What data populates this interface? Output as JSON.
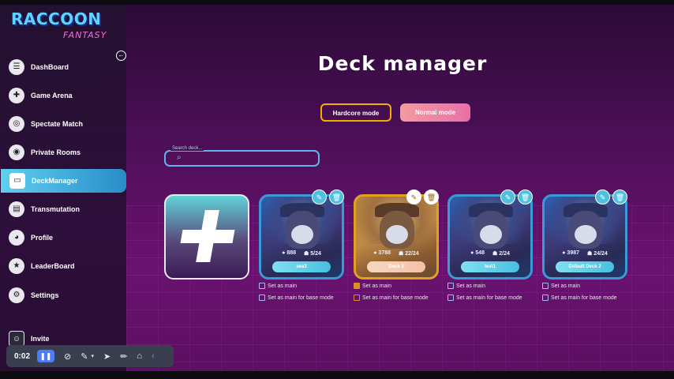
{
  "app": {
    "logo_line1": "RACCOON",
    "logo_line2": "FANTASY"
  },
  "sidebar": {
    "items": [
      {
        "label": "DashBoard",
        "icon": "list-icon",
        "glyph": "☰"
      },
      {
        "label": "Game Arena",
        "icon": "gamepad-icon",
        "glyph": "🎮"
      },
      {
        "label": "Spectate Match",
        "icon": "eye-icon",
        "glyph": "👁"
      },
      {
        "label": "Private Rooms",
        "icon": "globe-icon",
        "glyph": "◉"
      },
      {
        "label": "DeckManager",
        "icon": "deck-icon",
        "glyph": "▭",
        "active": true
      },
      {
        "label": "Transmutation",
        "icon": "window-icon",
        "glyph": "▤"
      },
      {
        "label": "Profile",
        "icon": "raccoon-icon",
        "glyph": "◕"
      },
      {
        "label": "LeaderBoard",
        "icon": "star-icon",
        "glyph": "★"
      },
      {
        "label": "Settings",
        "icon": "gear-icon",
        "glyph": "⚙"
      }
    ],
    "invite_label": "Invite"
  },
  "recorder": {
    "time": "0:02"
  },
  "main": {
    "title": "Deck manager",
    "modes": {
      "hardcore": "Hardcore mode",
      "normal": "Normal mode"
    },
    "search_placeholder": "Search deck..."
  },
  "decks": [
    {
      "name": "sea3",
      "coins": "888",
      "cards": "5/24",
      "set_main": "Set as main",
      "set_base": "Set as main for base mode",
      "selected": false
    },
    {
      "name": "Deck 3",
      "coins": "3788",
      "cards": "22/24",
      "set_main": "Set as main",
      "set_base": "Set as main for base mode",
      "selected": true
    },
    {
      "name": "test1",
      "coins": "548",
      "cards": "2/24",
      "set_main": "Set as main",
      "set_base": "Set as main for base mode",
      "selected": false
    },
    {
      "name": "Default Deck 2",
      "coins": "3987",
      "cards": "24/24",
      "set_main": "Set as main",
      "set_base": "Set as main for base mode",
      "selected": false
    }
  ],
  "colors": {
    "accent": "#4fc0e0",
    "selected": "#e0a020",
    "hardcore_border": "#f0b000",
    "normal_bg": "#f08aa8"
  }
}
